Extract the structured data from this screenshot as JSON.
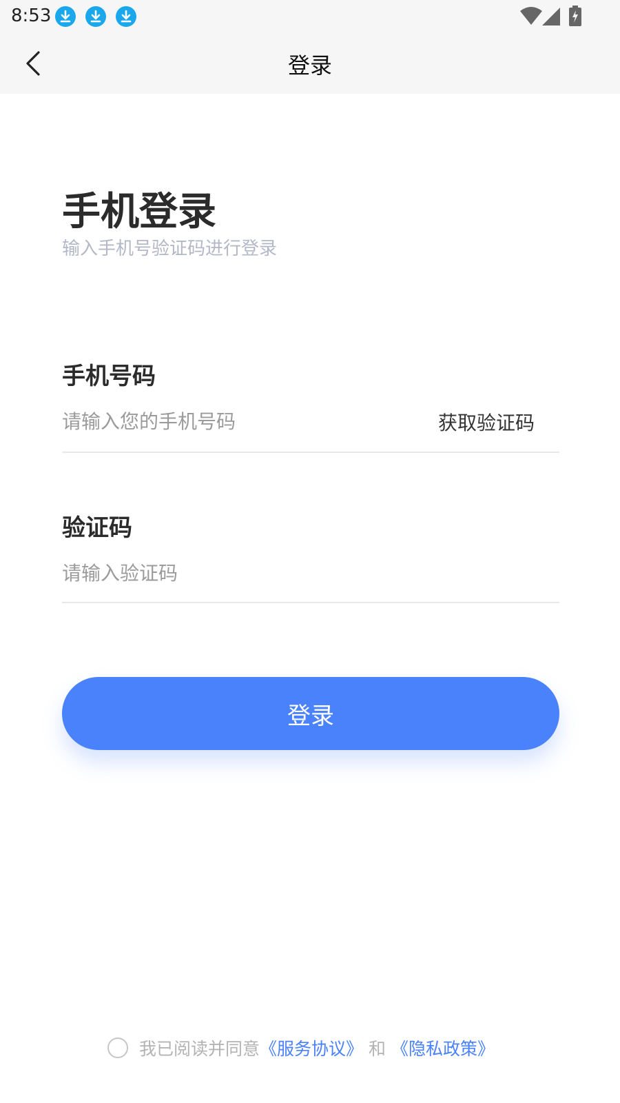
{
  "status_bar": {
    "time": "8:53",
    "download_icons": [
      "download-icon",
      "download-icon",
      "download-icon"
    ],
    "system_icons": [
      "wifi-icon",
      "signal-icon",
      "battery-charging-icon"
    ]
  },
  "nav": {
    "title": "登录",
    "back_icon": "chevron-left-icon"
  },
  "header": {
    "title": "手机登录",
    "subtitle": "输入手机号验证码进行登录"
  },
  "phone": {
    "label": "手机号码",
    "placeholder": "请输入您的手机号码",
    "value": "",
    "get_code_label": "获取验证码"
  },
  "code": {
    "label": "验证码",
    "placeholder": "请输入验证码",
    "value": ""
  },
  "login_button": {
    "label": "登录"
  },
  "agreement": {
    "checked": false,
    "prefix": "我已阅读并同意",
    "service_link": "《服务协议》",
    "and": "和",
    "privacy_link": "《隐私政策》"
  },
  "colors": {
    "accent": "#4a82fb",
    "download_badge": "#1aa7ec"
  }
}
